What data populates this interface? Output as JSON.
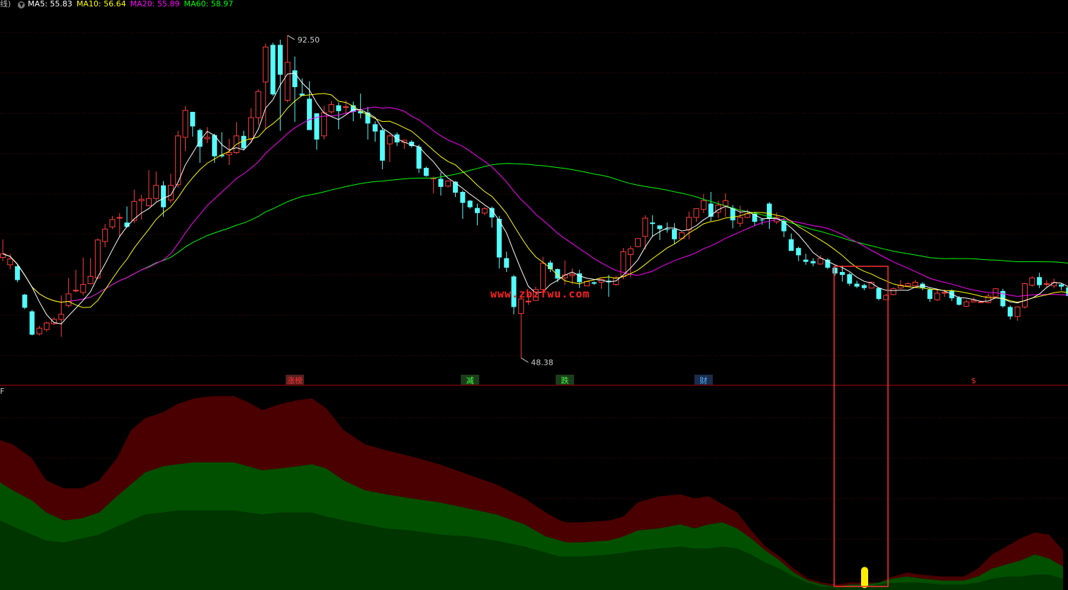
{
  "header": {
    "prefix": "线)",
    "ma_items": [
      {
        "label": "MA5: 55.83",
        "color": "#ffffff"
      },
      {
        "label": "MA10: 56.64",
        "color": "#ffff00"
      },
      {
        "label": "MA20: 55.89",
        "color": "#ff00ff"
      },
      {
        "label": "MA60: 58.97",
        "color": "#00ff00"
      }
    ]
  },
  "lower_panel_label": "F",
  "watermark": "www.zbzfwu.com",
  "chart_data": [
    {
      "type": "candlestick",
      "high_label": "92.50",
      "low_label": "48.38",
      "y_range": [
        46,
        96
      ],
      "colors": {
        "up": "#ff3b3b",
        "down": "#54fcfc",
        "ma5": "#ffffff",
        "ma10": "#ffff00",
        "ma20": "#ff00ff",
        "ma60": "#00ff00"
      },
      "candles": [
        [
          62,
          62.5,
          64.5,
          61.5
        ],
        [
          61,
          61.8,
          62.5,
          60.4
        ],
        [
          60.8,
          58.9,
          61,
          58.6
        ],
        [
          56.9,
          55.1,
          57,
          54.9
        ],
        [
          54.6,
          51.4,
          54.8,
          51.3
        ],
        [
          51.5,
          52.3,
          52.6,
          51.3
        ],
        [
          52.1,
          53,
          53.2,
          51.8
        ],
        [
          52.9,
          53.5,
          53.8,
          52.7
        ],
        [
          53.5,
          54.2,
          56.8,
          51.1
        ],
        [
          55.4,
          57,
          59.2,
          55.1
        ],
        [
          57.5,
          57.5,
          60.3,
          57.2
        ],
        [
          57.2,
          58.3,
          62,
          56.8
        ],
        [
          58.4,
          59.4,
          61.9,
          58.3
        ],
        [
          59.2,
          64.4,
          64.6,
          59
        ],
        [
          64.2,
          65.9,
          66.6,
          63.4
        ],
        [
          66.2,
          67.2,
          67.7,
          65.9
        ],
        [
          67.4,
          67.5,
          68.1,
          64.8
        ],
        [
          66.8,
          66.2,
          69,
          66.1
        ],
        [
          67.1,
          69.7,
          71.3,
          66.7
        ],
        [
          69.8,
          70,
          70.6,
          67.2
        ],
        [
          69.1,
          70.1,
          74,
          69
        ],
        [
          70.1,
          71.9,
          73.8,
          69.7
        ],
        [
          71.9,
          68.9,
          72.5,
          67.6
        ],
        [
          69.9,
          71.9,
          73.5,
          69.5
        ],
        [
          72,
          78.7,
          79.4,
          71.6
        ],
        [
          78.5,
          82.2,
          82.8,
          76.6
        ],
        [
          82,
          80,
          81.6,
          78.6
        ],
        [
          79.5,
          77.2,
          79.7,
          75
        ],
        [
          78.3,
          78.5,
          79.9,
          77.7
        ],
        [
          78.8,
          75.9,
          79,
          75
        ],
        [
          76.1,
          75.9,
          79.2,
          75.7
        ],
        [
          76.1,
          76.4,
          78.3,
          74.7
        ],
        [
          76.4,
          78.7,
          80.6,
          76.2
        ],
        [
          78.7,
          77,
          79.4,
          76.7
        ],
        [
          78.3,
          81.2,
          82.5,
          77.7
        ],
        [
          81.2,
          84.8,
          85.1,
          80.2
        ],
        [
          86.1,
          90.9,
          91.4,
          79.6
        ],
        [
          91.2,
          84.4,
          91.5,
          84.2
        ],
        [
          91.2,
          87.1,
          91.9,
          79.4
        ],
        [
          83.6,
          88.8,
          92.5,
          83.3
        ],
        [
          87.7,
          85.4,
          89.6,
          80.6
        ],
        [
          84.5,
          84.2,
          86.6,
          84.2
        ],
        [
          83.8,
          79.5,
          86.2,
          80.5
        ],
        [
          81.8,
          78.2,
          81.6,
          76.8
        ],
        [
          78.7,
          81.9,
          82.8,
          78.2
        ],
        [
          82,
          83,
          83.5,
          81.8
        ],
        [
          82.9,
          82.1,
          83.3,
          79.6
        ],
        [
          82.6,
          82.7,
          83.6,
          81.7
        ],
        [
          82.9,
          82,
          83.4,
          80.7
        ],
        [
          82.1,
          81.8,
          84.5,
          81.1
        ],
        [
          81.9,
          80.4,
          82.7,
          78.2
        ],
        [
          80.3,
          79.3,
          80.7,
          77.9
        ],
        [
          79.5,
          75.3,
          79.7,
          74.1
        ],
        [
          77.6,
          78.7,
          78.9,
          75.1
        ],
        [
          78.9,
          77.8,
          79.2,
          77.3
        ],
        [
          77.8,
          78.1,
          78.2,
          76.9
        ],
        [
          77.9,
          77.3,
          78.1,
          77.1
        ],
        [
          77.2,
          74.2,
          77.5,
          73.6
        ],
        [
          74.3,
          73.2,
          74.5,
          73.1
        ],
        [
          72.8,
          72.9,
          73.1,
          70.8
        ],
        [
          72.8,
          71.7,
          73.7,
          70.5
        ],
        [
          71.8,
          72.5,
          72.6,
          71.6
        ],
        [
          72.4,
          70.9,
          72.5,
          70.3
        ],
        [
          71,
          69.5,
          71.2,
          67.3
        ],
        [
          69.8,
          68.9,
          69.9,
          68.7
        ],
        [
          68.8,
          68.1,
          69.4,
          66.4
        ],
        [
          68.1,
          68.7,
          68.9,
          67.8
        ],
        [
          68.8,
          67.5,
          69,
          66.1
        ],
        [
          67.3,
          62,
          67.7,
          60.5
        ],
        [
          61.9,
          60.6,
          62.8,
          60
        ],
        [
          59.4,
          55.2,
          59.6,
          54.2
        ],
        [
          54.3,
          56.3,
          56.8,
          48.2
        ],
        [
          55.9,
          56,
          57,
          55.5
        ],
        [
          56.1,
          57.6,
          58,
          57.1
        ],
        [
          57.6,
          61.2,
          62.1,
          58.8
        ],
        [
          61.3,
          60.4,
          61.6,
          60
        ],
        [
          60.4,
          59.1,
          60.5,
          58.6
        ],
        [
          59.2,
          59.6,
          61.6,
          58.2
        ],
        [
          59.5,
          59.7,
          60.5,
          58.3
        ],
        [
          59.8,
          58.6,
          60.3,
          57.8
        ],
        [
          58.1,
          58.7,
          58.8,
          58.6
        ],
        [
          58.6,
          58.4,
          58.7,
          58.2
        ],
        [
          58.6,
          59,
          59,
          57.7
        ],
        [
          58.8,
          58.6,
          59.6,
          56.6
        ],
        [
          58.3,
          59.2,
          59.5,
          58.1
        ],
        [
          59.4,
          62.8,
          63.3,
          59
        ],
        [
          62.4,
          63.2,
          63.6,
          59.3
        ],
        [
          63.5,
          64.6,
          64.6,
          63.4
        ],
        [
          64.9,
          67.4,
          67.8,
          63.1
        ],
        [
          66.8,
          66.6,
          67.8,
          64.8
        ],
        [
          66.4,
          65.9,
          66.4,
          64.4
        ],
        [
          65.9,
          65.8,
          66.8,
          65.4
        ],
        [
          65.9,
          64.5,
          66.7,
          63.8
        ],
        [
          64.6,
          65.4,
          65.5,
          65.3
        ],
        [
          65.8,
          67.5,
          68.3,
          64.5
        ],
        [
          67.5,
          68.7,
          68.7,
          66.9
        ],
        [
          68.6,
          69.8,
          70.7,
          68.1
        ],
        [
          69.4,
          67.6,
          71,
          67
        ],
        [
          68.2,
          69.2,
          69.8,
          67.4
        ],
        [
          69.1,
          69.8,
          70.8,
          67.6
        ],
        [
          68.8,
          67.1,
          69.2,
          66
        ],
        [
          66.7,
          67.5,
          69.1,
          66.2
        ],
        [
          67.5,
          68,
          68.6,
          67.4
        ],
        [
          68,
          66.9,
          68.1,
          66.3
        ],
        [
          67.2,
          67.1,
          67.4,
          66.5
        ],
        [
          69.4,
          67.3,
          69.6,
          65.9
        ],
        [
          66.9,
          67.5,
          68.2,
          66.6
        ],
        [
          67,
          65.6,
          67.4,
          64.8
        ],
        [
          64.5,
          62.9,
          65.3,
          63.2
        ],
        [
          63.3,
          62.3,
          63.5,
          61.5
        ],
        [
          61.7,
          61.4,
          62.5,
          61
        ],
        [
          61.5,
          61.2,
          61.9,
          60.8
        ],
        [
          61.1,
          61.9,
          62.3,
          61
        ],
        [
          61.7,
          60.6,
          61.9,
          60.4
        ],
        [
          60.6,
          59.8,
          60.7,
          59.5
        ],
        [
          60,
          59.6,
          60.9,
          58.7
        ],
        [
          59.7,
          58.4,
          59.9,
          58.1
        ],
        [
          58.4,
          58,
          58.8,
          57.8
        ],
        [
          58.2,
          57.8,
          58.4,
          57.5
        ],
        [
          57.8,
          58.6,
          58.7,
          57.8
        ],
        [
          57.8,
          56.3,
          57.9,
          56.1
        ],
        [
          56.2,
          56.8,
          57,
          56.2
        ],
        [
          56.9,
          57.7,
          57.9,
          56.8
        ],
        [
          57.8,
          58.2,
          58.9,
          57.7
        ],
        [
          58.1,
          58.4,
          58.6,
          58
        ],
        [
          58.1,
          58.6,
          58.9,
          58
        ],
        [
          58.4,
          57.8,
          58.6,
          57.5
        ],
        [
          57.6,
          56.3,
          57.9,
          55.9
        ],
        [
          56.2,
          57.1,
          57.6,
          56
        ],
        [
          57.2,
          57.2,
          57.6,
          56.6
        ],
        [
          57.4,
          56.4,
          57.6,
          56
        ],
        [
          56.5,
          55.5,
          56.7,
          55.4
        ],
        [
          55.3,
          55.9,
          56.2,
          55.2
        ],
        [
          55.9,
          56.1,
          56.5,
          55.8
        ],
        [
          55.9,
          55.9,
          56.1,
          55.8
        ],
        [
          55.8,
          56.7,
          57,
          55.7
        ],
        [
          56.6,
          57.7,
          57.8,
          56.4
        ],
        [
          57.4,
          55.3,
          57.7,
          55.1
        ],
        [
          55.2,
          53.9,
          55.4,
          53.5
        ],
        [
          53.9,
          55.2,
          55.3,
          53.3
        ],
        [
          55.2,
          58.4,
          58.5,
          55
        ],
        [
          58.2,
          59.2,
          59.4,
          58
        ],
        [
          59.3,
          58.2,
          59.9,
          57.8
        ],
        [
          58.3,
          58.4,
          58.9,
          58
        ],
        [
          58.1,
          58.6,
          59.1,
          57.8
        ],
        [
          58.3,
          58,
          58.5,
          57.5
        ],
        [
          57.9,
          56.7,
          58.2,
          56.4
        ],
        [
          56.8,
          57.2,
          57.6,
          56.3
        ],
        [
          57,
          56.3,
          57.3,
          55.4
        ],
        [
          56.4,
          57,
          57.2,
          55.6
        ]
      ],
      "markers": [
        {
          "label": "涨榜",
          "color": "#ff3030",
          "bg": "#552020",
          "index": 40
        },
        {
          "label": "减",
          "color": "#40ff40",
          "bg": "#1c3d1c",
          "index": 64
        },
        {
          "label": "跌",
          "color": "#40ff40",
          "bg": "#1c3d1c",
          "index": 77
        },
        {
          "label": "财",
          "color": "#50b0ff",
          "bg": "#1c2c4d",
          "index": 96
        },
        {
          "label": "$",
          "color": "#ff3030",
          "bg": "",
          "index": 133
        }
      ]
    },
    {
      "type": "area",
      "y_range": [
        0,
        100
      ],
      "x": [
        0,
        18,
        45,
        65,
        90,
        115,
        140,
        165,
        185,
        205,
        230,
        250,
        275,
        300,
        330,
        350,
        370,
        395,
        420,
        440,
        460,
        485,
        515,
        545,
        580,
        620,
        660,
        700,
        740,
        770,
        790,
        800,
        820,
        860,
        880,
        900,
        930,
        960,
        980,
        1000,
        1020,
        1040,
        1060,
        1080,
        1100,
        1120,
        1140,
        1160,
        1180,
        1200,
        1220,
        1240,
        1260,
        1280,
        1300,
        1330,
        1360,
        1380,
        1400,
        1420,
        1440,
        1460,
        1480,
        1500
      ],
      "series": [
        {
          "name": "",
          "color": "#4a0000",
          "values": [
            74,
            72,
            65,
            54,
            50,
            50,
            54,
            65,
            79,
            85,
            88,
            92,
            95,
            96,
            96,
            93,
            89,
            92,
            94,
            95,
            90,
            79,
            72,
            69,
            66,
            62,
            57,
            52,
            45,
            38,
            34,
            33,
            33,
            34,
            36,
            43,
            46,
            47,
            45,
            46,
            42,
            38,
            29,
            21,
            16,
            10,
            5,
            3,
            2,
            3,
            3,
            3,
            6,
            8,
            7,
            6,
            6,
            10,
            17,
            21,
            25,
            28,
            27,
            19
          ]
        },
        {
          "name": "",
          "color": "#005000",
          "values": [
            53,
            49,
            44,
            38,
            34,
            35,
            38,
            46,
            52,
            58,
            61,
            62,
            63,
            63,
            63,
            61,
            59,
            60,
            61,
            62,
            60,
            54,
            49,
            47,
            45,
            43,
            40,
            37,
            32,
            26,
            24,
            23,
            23,
            24,
            26,
            29,
            30,
            32,
            30,
            32,
            33,
            30,
            25,
            19,
            14,
            8,
            4,
            2,
            1,
            2,
            2,
            3,
            5,
            6,
            5,
            4,
            4,
            6,
            10,
            12,
            14,
            17,
            15,
            11
          ]
        },
        {
          "name": "",
          "color": "#003500",
          "values": [
            34,
            31,
            27,
            24,
            23,
            25,
            27,
            31,
            34,
            37,
            38,
            39,
            39,
            39,
            39,
            38,
            37,
            38,
            38,
            38,
            36,
            34,
            32,
            30,
            29,
            27,
            26,
            24,
            21,
            18,
            16,
            16,
            16,
            17,
            18,
            19,
            20,
            21,
            20,
            20,
            21,
            20,
            17,
            13,
            10,
            6,
            3,
            1,
            1,
            1,
            1,
            2,
            3,
            3,
            3,
            2,
            2,
            3,
            5,
            6,
            6,
            7,
            7,
            5
          ]
        }
      ],
      "indicator": {
        "x": 1220,
        "value": 8,
        "color": "#ffee00"
      }
    }
  ],
  "highlight_box": {
    "color": "#ff3030"
  }
}
